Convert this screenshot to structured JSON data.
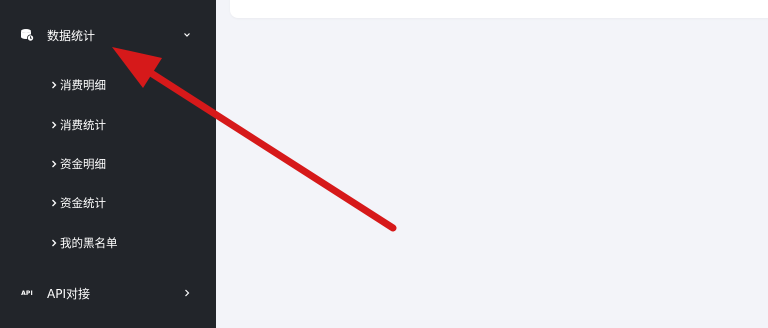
{
  "sidebar": {
    "groups": [
      {
        "label": "数据统计",
        "icon": "database-stats-icon",
        "expanded": true,
        "items": [
          {
            "label": "消费明细"
          },
          {
            "label": "消费统计"
          },
          {
            "label": "资金明细"
          },
          {
            "label": "资金统计"
          },
          {
            "label": "我的黑名单"
          }
        ]
      },
      {
        "label": "API对接",
        "icon": "api-icon",
        "icon_text": "API",
        "expanded": false
      }
    ]
  },
  "colors": {
    "sidebar_bg": "#22252a",
    "content_bg": "#f3f4f9",
    "annotation_arrow": "#d6191a"
  }
}
